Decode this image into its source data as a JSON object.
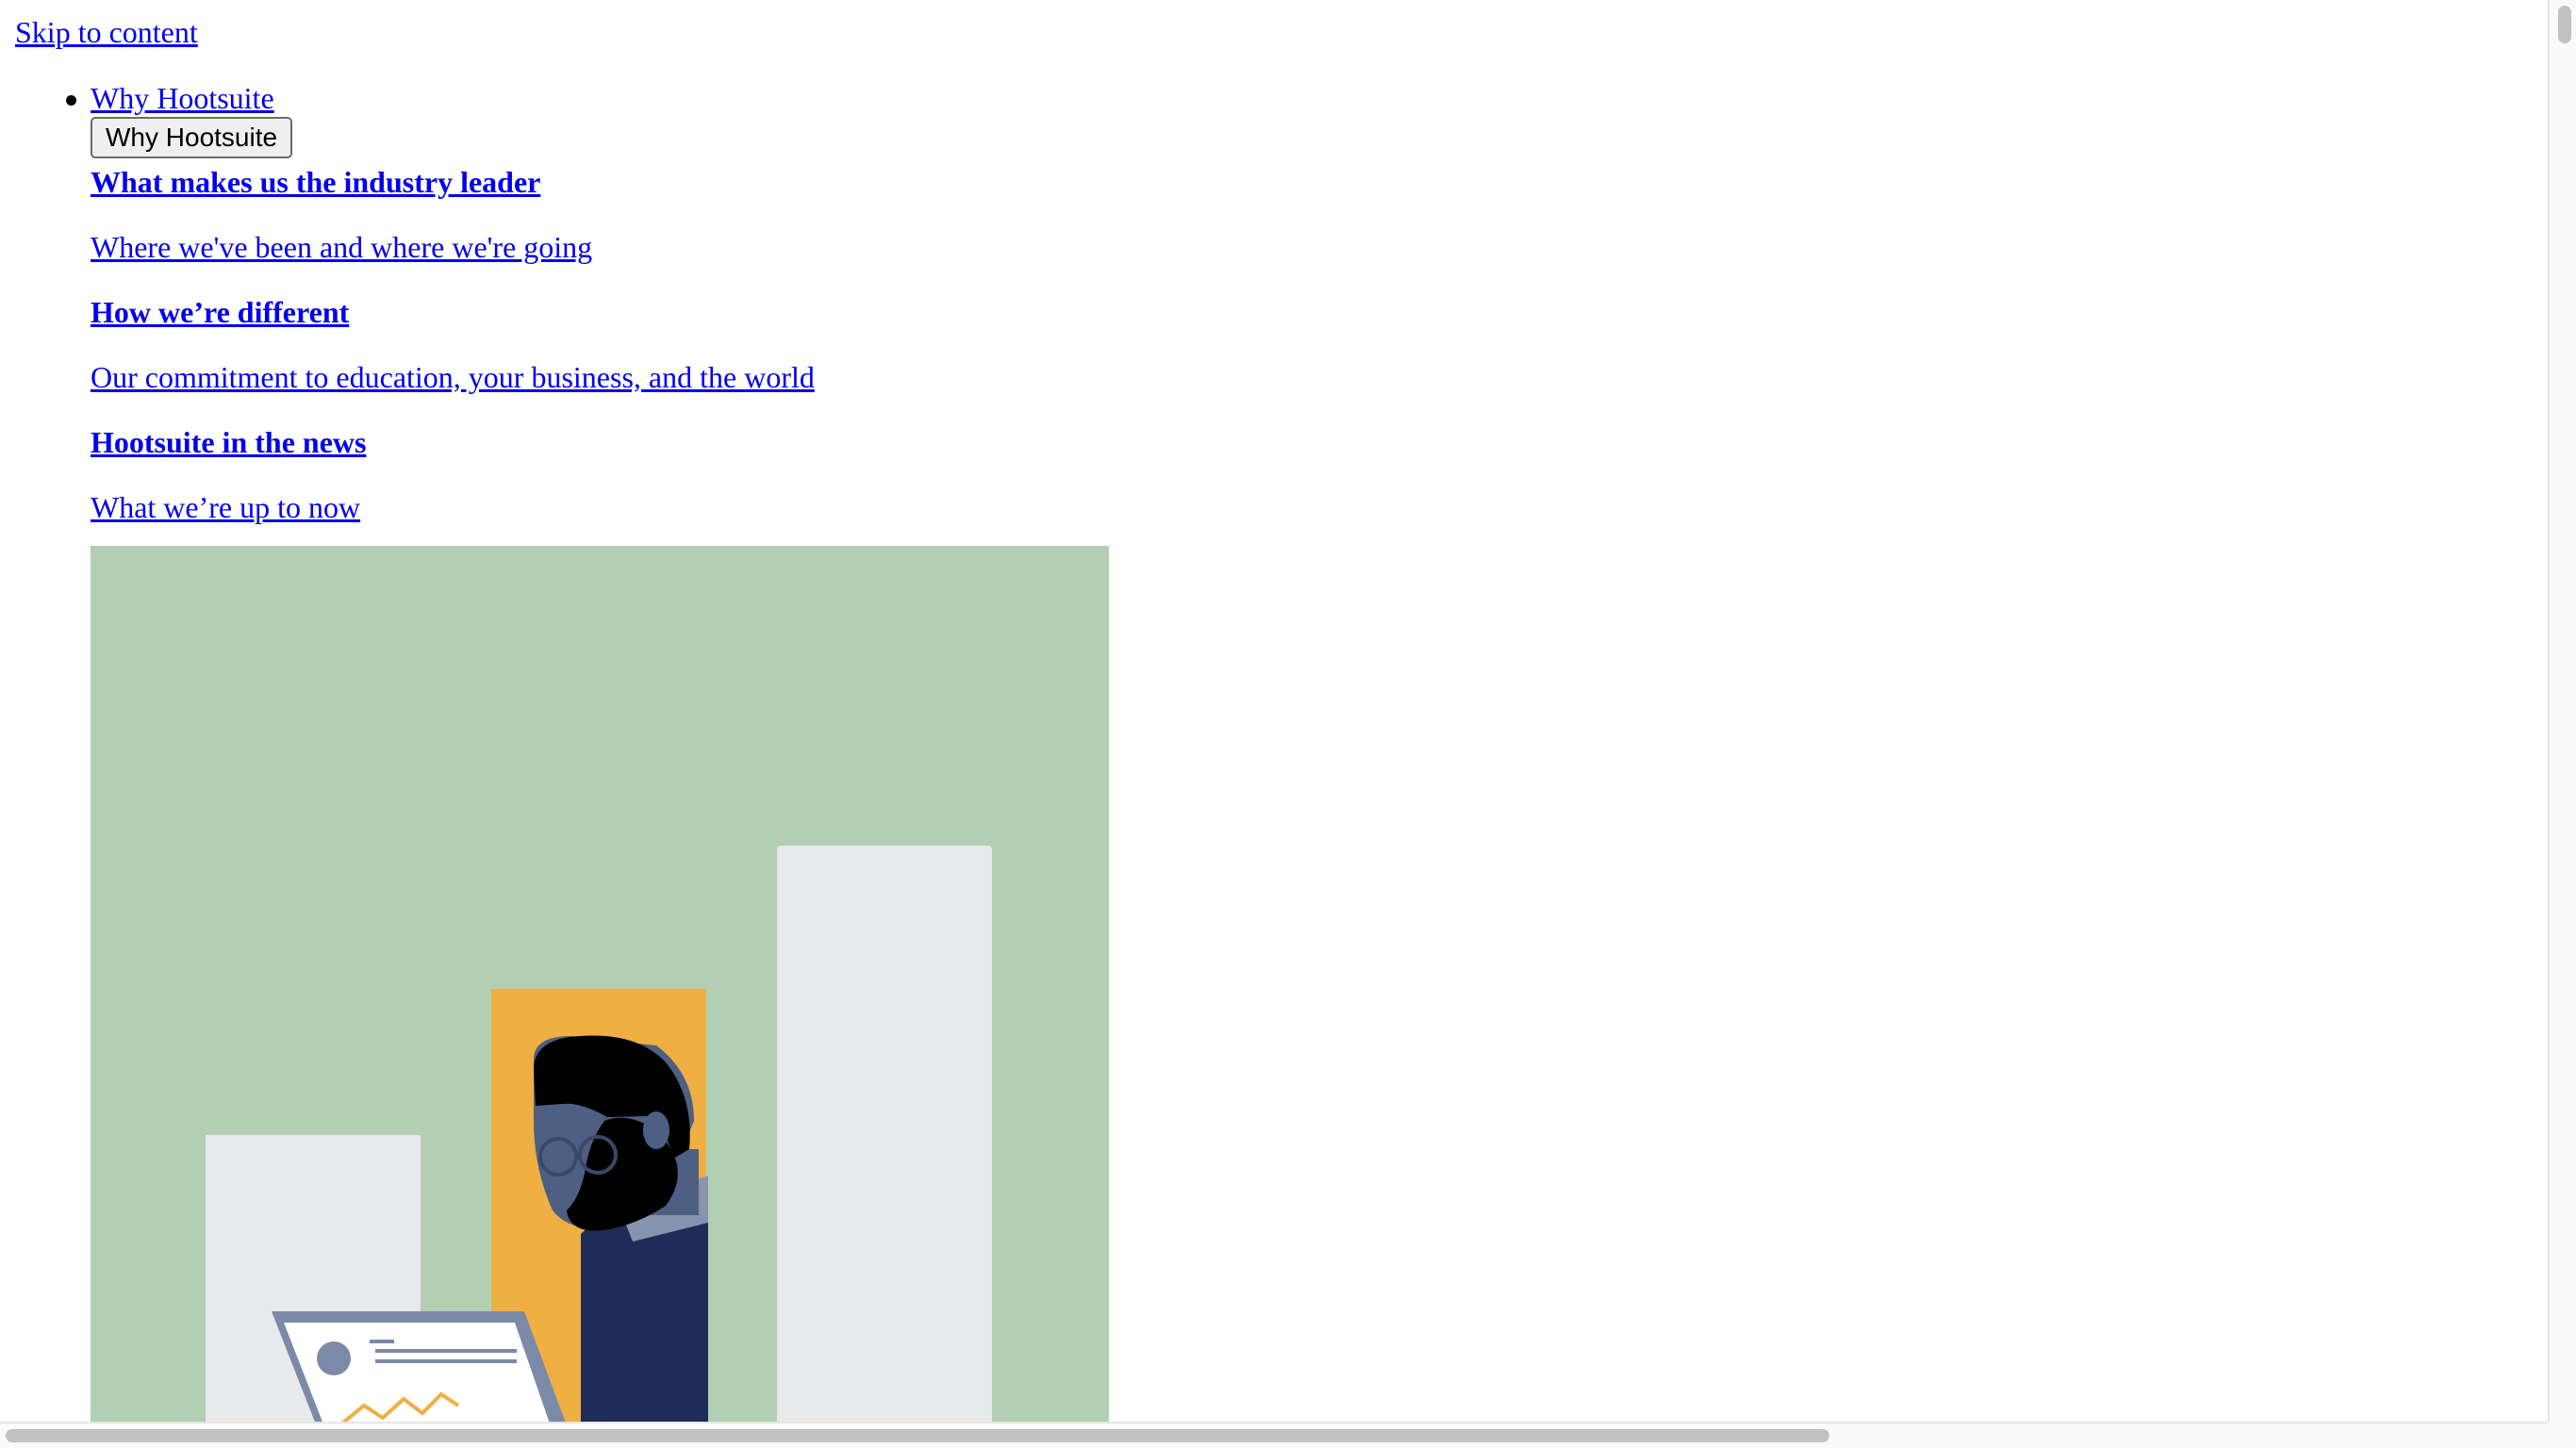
{
  "skip_link": "Skip to content",
  "nav": {
    "item_link": "Why Hootsuite",
    "menu_button": "Why Hootsuite",
    "submenu": [
      {
        "label": "What makes us the industry leader",
        "bold": true
      },
      {
        "label": "Where we've been and where we're going",
        "bold": false
      },
      {
        "label": "How we’re different",
        "bold": true
      },
      {
        "label": "Our commitment to education, your business, and the world",
        "bold": false
      },
      {
        "label": "Hootsuite in the news",
        "bold": true
      },
      {
        "label": "What we’re up to now",
        "bold": false
      }
    ]
  },
  "colors": {
    "link": "#0000ee",
    "illustration_bg": "#b2cfb4",
    "bar_light": "#e7e9eb",
    "bar_accent": "#efaf43",
    "jacket": "#1d2d57",
    "skin": "#4d5f82"
  }
}
